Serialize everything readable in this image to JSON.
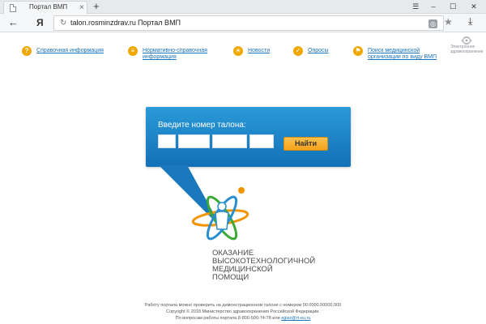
{
  "browser": {
    "tab_title": "Портал ВМП",
    "tab_close": "×",
    "new_tab": "+",
    "controls": {
      "menu": "☰",
      "minimize": "–",
      "maximize": "☐",
      "close": "✕"
    },
    "back": "←",
    "logo": "Я",
    "reload": "↻",
    "url_domain": "talon.rosminzdrav.ru",
    "url_title": "Портал ВМП",
    "ext": "◎",
    "star": "★",
    "download": "⤓"
  },
  "brand": {
    "line1": "Электронное",
    "line2": "здравоохранение"
  },
  "nav": {
    "items": [
      {
        "label_line1": "Справочная информация",
        "label_line2": "",
        "icon": "question-icon",
        "glyph": "?"
      },
      {
        "label_line1": "Нормативно-справочная",
        "label_line2": "информация",
        "icon": "document-icon",
        "glyph": "≡"
      },
      {
        "label_line1": "Новости",
        "label_line2": "",
        "icon": "news-icon",
        "glyph": "☀"
      },
      {
        "label_line1": "Опросы",
        "label_line2": "",
        "icon": "chat-icon",
        "glyph": "✓"
      },
      {
        "label_line1": "Поиск медицинской",
        "label_line2": "организации по виду ВМП",
        "icon": "map-icon",
        "glyph": "⚑"
      }
    ]
  },
  "search": {
    "title": "Введите номер талона:",
    "fields": [
      "",
      "",
      "",
      ""
    ],
    "button": "Найти"
  },
  "project": {
    "line1": "ОКАЗАНИЕ",
    "line2": "ВЫСОКОТЕХНОЛОГИЧНОЙ",
    "line3": "МЕДИЦИНСКОЙ",
    "line4": "ПОМОЩИ"
  },
  "footer": {
    "line1": "Работу портала можно проверить на демонстрационном талоне с номером 00.0000.00000.000",
    "line2": "Copyright © 2018 Министерство здравоохранения Российской Федерации.",
    "line3_prefix": "По вопросам работы портала 8-800-500-74-78 или",
    "email": "egisz@rt-eu.ru"
  },
  "colors": {
    "panel": "#1a82c8",
    "button": "#f5a623",
    "nav_icon": "#f0a800",
    "link": "#1a72b8"
  }
}
